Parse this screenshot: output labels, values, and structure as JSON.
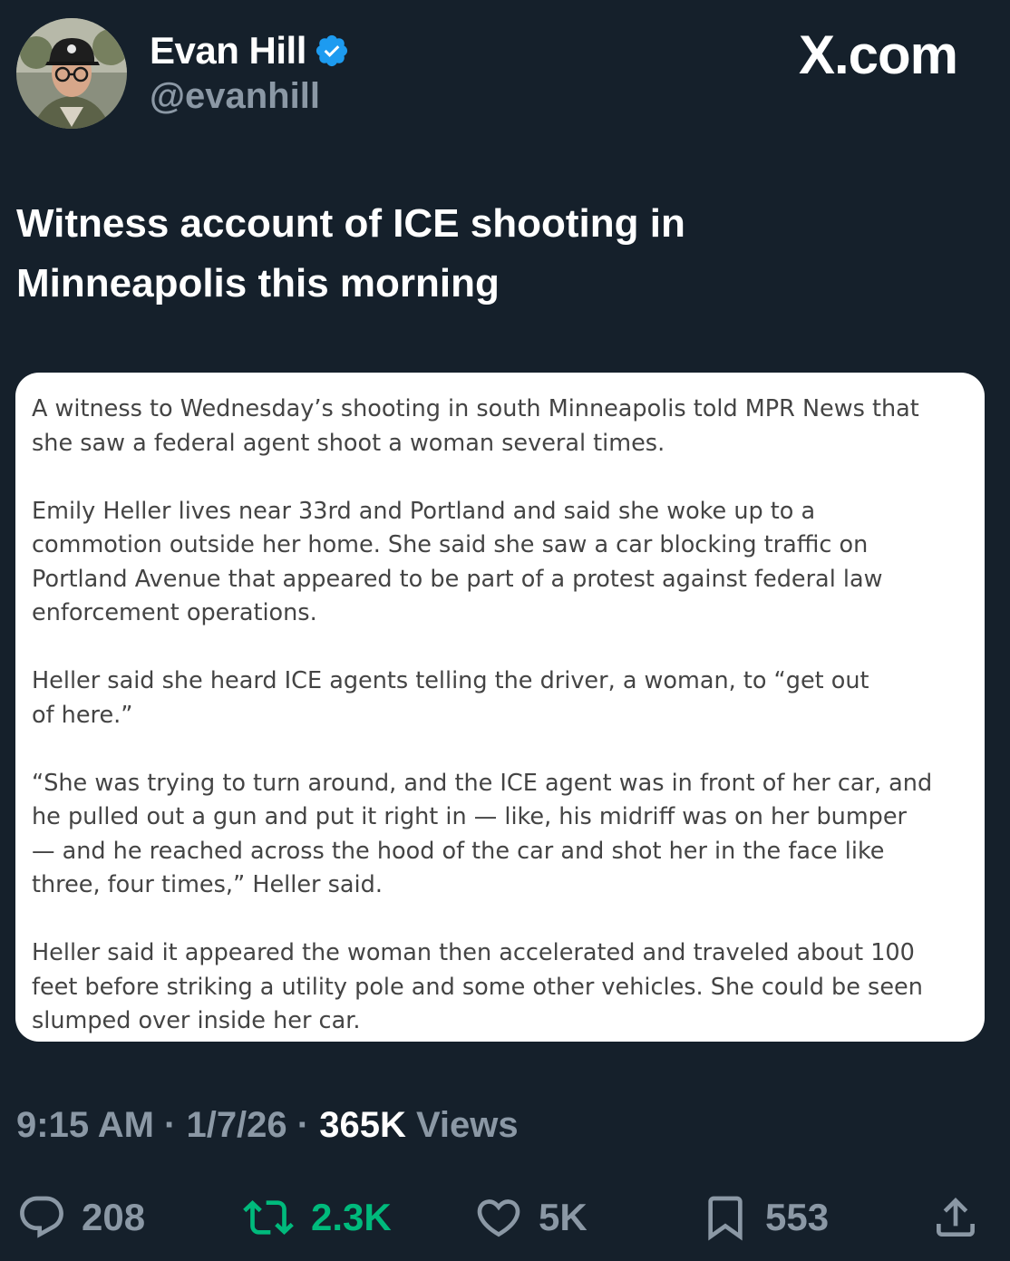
{
  "author": {
    "display_name": "Evan Hill",
    "handle": "@evanhill",
    "verified": true,
    "verified_color": "#1d9bf0"
  },
  "site_logo": "X.com",
  "tweet": {
    "text": "Witness account of ICE shooting in\nMinneapolis this morning"
  },
  "card": {
    "paragraphs": [
      "A witness to Wednesday’s shooting in south Minneapolis told MPR News that\nshe saw a federal agent shoot a woman several times.",
      "Emily Heller lives near 33rd and Portland and said she woke up to a\ncommotion outside her home. She said she saw a car blocking traffic on\nPortland Avenue that appeared to be part of a protest against federal law\nenforcement operations.",
      "Heller said she heard ICE agents telling the driver, a woman, to “get out\nof here.”",
      "“She was trying to turn around, and the ICE agent was in front of her car, and\nhe pulled out a gun and put it right in — like, his midriff was on her bumper\n— and he reached across the hood of the car and shot her in the face like\nthree, four times,” Heller said.",
      "Heller said it appeared the woman then accelerated and traveled about 100\nfeet before striking a utility pole and some other vehicles. She could be seen\nslumped over inside her car."
    ]
  },
  "meta": {
    "time": "9:15 AM",
    "separator": " · ",
    "date": "1/7/26",
    "views_count": "365K",
    "views_label": " Views"
  },
  "actions": {
    "replies": "208",
    "retweets": "2.3K",
    "likes": "5K",
    "bookmarks": "553"
  },
  "colors": {
    "background": "#15202b",
    "secondary_text": "#8b98a5",
    "retweet_active": "#00ba7c"
  }
}
